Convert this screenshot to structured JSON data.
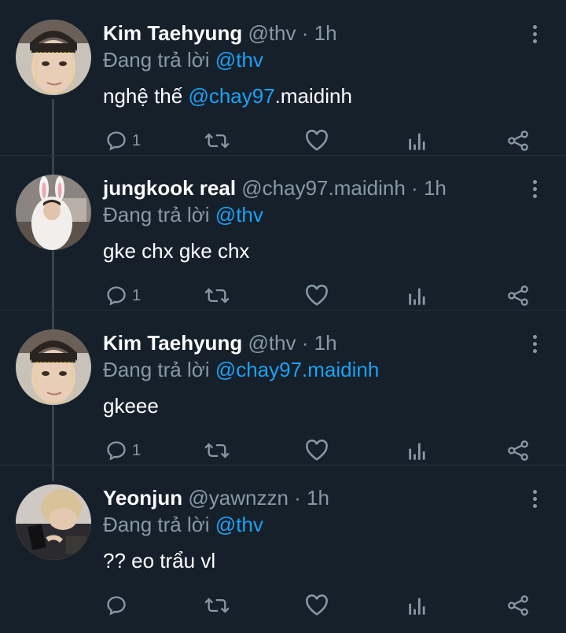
{
  "tweets": [
    {
      "name": "Kim Taehyung",
      "handle": "@thv",
      "separator": "·",
      "time": "1h",
      "reply_prefix": "Đang trả lời",
      "reply_to": "@thv",
      "text_segments": {
        "before": "nghệ thế ",
        "mention": "@chay97",
        "after": ".maidinh"
      },
      "reply_count": "1",
      "avatar_icon": "selfie-photo-avatar"
    },
    {
      "name": "jungkook real",
      "handle": "@chay97.maidinh",
      "separator": "·",
      "time": "1h",
      "reply_prefix": "Đang trả lời",
      "reply_to": "@thv",
      "text": "gke chx gke chx",
      "reply_count": "1",
      "avatar_icon": "bunny-costume-avatar"
    },
    {
      "name": "Kim Taehyung",
      "handle": "@thv",
      "separator": "·",
      "time": "1h",
      "reply_prefix": "Đang trả lời",
      "reply_to": "@chay97.maidinh",
      "text": "gkeee",
      "reply_count": "1",
      "avatar_icon": "selfie-photo-avatar"
    },
    {
      "name": "Yeonjun",
      "handle": "@yawnzzn",
      "separator": "·",
      "time": "1h",
      "reply_prefix": "Đang trả lời",
      "reply_to": "@thv",
      "text": "?? eo trẩu vl",
      "reply_count": "",
      "avatar_icon": "blond-photo-avatar"
    }
  ],
  "icons": {
    "reply": "reply-icon",
    "retweet": "retweet-icon",
    "like": "heart-icon",
    "analytics": "analytics-icon",
    "share": "share-icon",
    "more": "more-vertical-icon"
  },
  "colors": {
    "background": "#15202b",
    "primary_text": "#ffffff",
    "secondary_text": "#8899a6",
    "mention": "#1da1f2",
    "thread_line": "#38444d"
  }
}
